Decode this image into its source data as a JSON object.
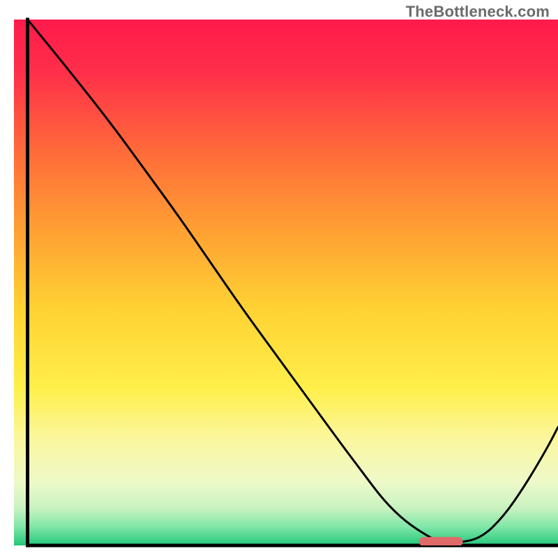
{
  "watermark": "TheBottleneck.com",
  "chart_data": {
    "type": "line",
    "title": "",
    "xlabel": "",
    "ylabel": "",
    "xlim": [
      0,
      100
    ],
    "ylim": [
      0,
      100
    ],
    "gradient_stops": [
      {
        "offset": 0.0,
        "color": "#ff1a4b"
      },
      {
        "offset": 0.1,
        "color": "#ff2f4a"
      },
      {
        "offset": 0.25,
        "color": "#ff6a3a"
      },
      {
        "offset": 0.4,
        "color": "#ffa033"
      },
      {
        "offset": 0.55,
        "color": "#ffd233"
      },
      {
        "offset": 0.7,
        "color": "#ffef4a"
      },
      {
        "offset": 0.8,
        "color": "#fbf7a0"
      },
      {
        "offset": 0.88,
        "color": "#eef9c9"
      },
      {
        "offset": 0.93,
        "color": "#c7f2c0"
      },
      {
        "offset": 0.965,
        "color": "#7fe6a7"
      },
      {
        "offset": 1.0,
        "color": "#23c77a"
      }
    ],
    "series": [
      {
        "name": "bottleneck-curve",
        "color": "#000000",
        "stroke_width": 3,
        "x": [
          2.5,
          10,
          18,
          24,
          30,
          36,
          42,
          48,
          54,
          60,
          64,
          68,
          72,
          76,
          78,
          82,
          86,
          90,
          94,
          98,
          100
        ],
        "y": [
          100,
          90.5,
          80,
          71.5,
          63,
          54,
          45,
          36.5,
          28,
          19.5,
          14,
          8.5,
          4.5,
          1.8,
          0.8,
          0.5,
          1.5,
          5.5,
          11.5,
          18.5,
          22.5
        ]
      }
    ],
    "marker": {
      "name": "optimal-marker",
      "shape": "capsule",
      "color": "#e06a6a",
      "cx": 78.5,
      "cy": 0.7,
      "width": 8.0,
      "height": 1.8
    },
    "axes": {
      "left": {
        "x": 2.5,
        "y0": 0,
        "y1": 100
      },
      "bottom": {
        "y": 0,
        "x0": 2.5,
        "x1": 100
      }
    }
  }
}
